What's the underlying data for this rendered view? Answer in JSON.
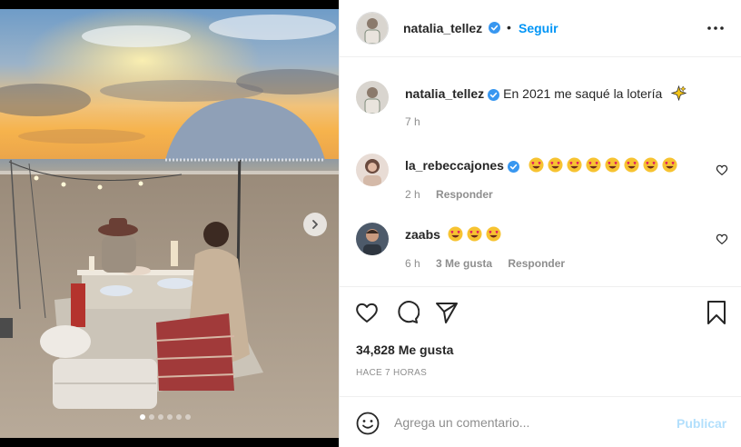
{
  "post": {
    "author": "natalia_tellez",
    "follow_label": "Seguir",
    "separator": "•",
    "caption_text": "En 2021 me saqué la lotería",
    "caption_emoji": "sparkles-emoji",
    "caption_time": "7 h",
    "image_count": 6,
    "active_image_index": 1
  },
  "comments": [
    {
      "user": "la_rebeccajones",
      "verified": true,
      "emoji": "heart-eyes-emoji",
      "emoji_count": 8,
      "time": "2 h",
      "likes": "",
      "reply_label": "Responder"
    },
    {
      "user": "zaabs",
      "verified": false,
      "emoji": "heart-eyes-emoji",
      "emoji_count": 3,
      "time": "6 h",
      "likes": "3 Me gusta",
      "reply_label": "Responder"
    }
  ],
  "stats": {
    "likes": "34,828 Me gusta",
    "time_ago": "HACE 7 HORAS"
  },
  "composer": {
    "placeholder": "Agrega un comentario...",
    "publish_label": "Publicar"
  },
  "colors": {
    "accent": "#0095f6",
    "publish_disabled": "#b2dffc",
    "muted": "#8e8e8e",
    "text": "#262626",
    "verified": "#3897f0"
  },
  "icons": {
    "more": "more-dots-icon",
    "like": "heart-outline-icon",
    "comment": "comment-bubble-icon",
    "share": "paper-plane-icon",
    "save": "bookmark-icon",
    "emoji_picker": "smiley-icon",
    "next": "chevron-right-icon"
  }
}
